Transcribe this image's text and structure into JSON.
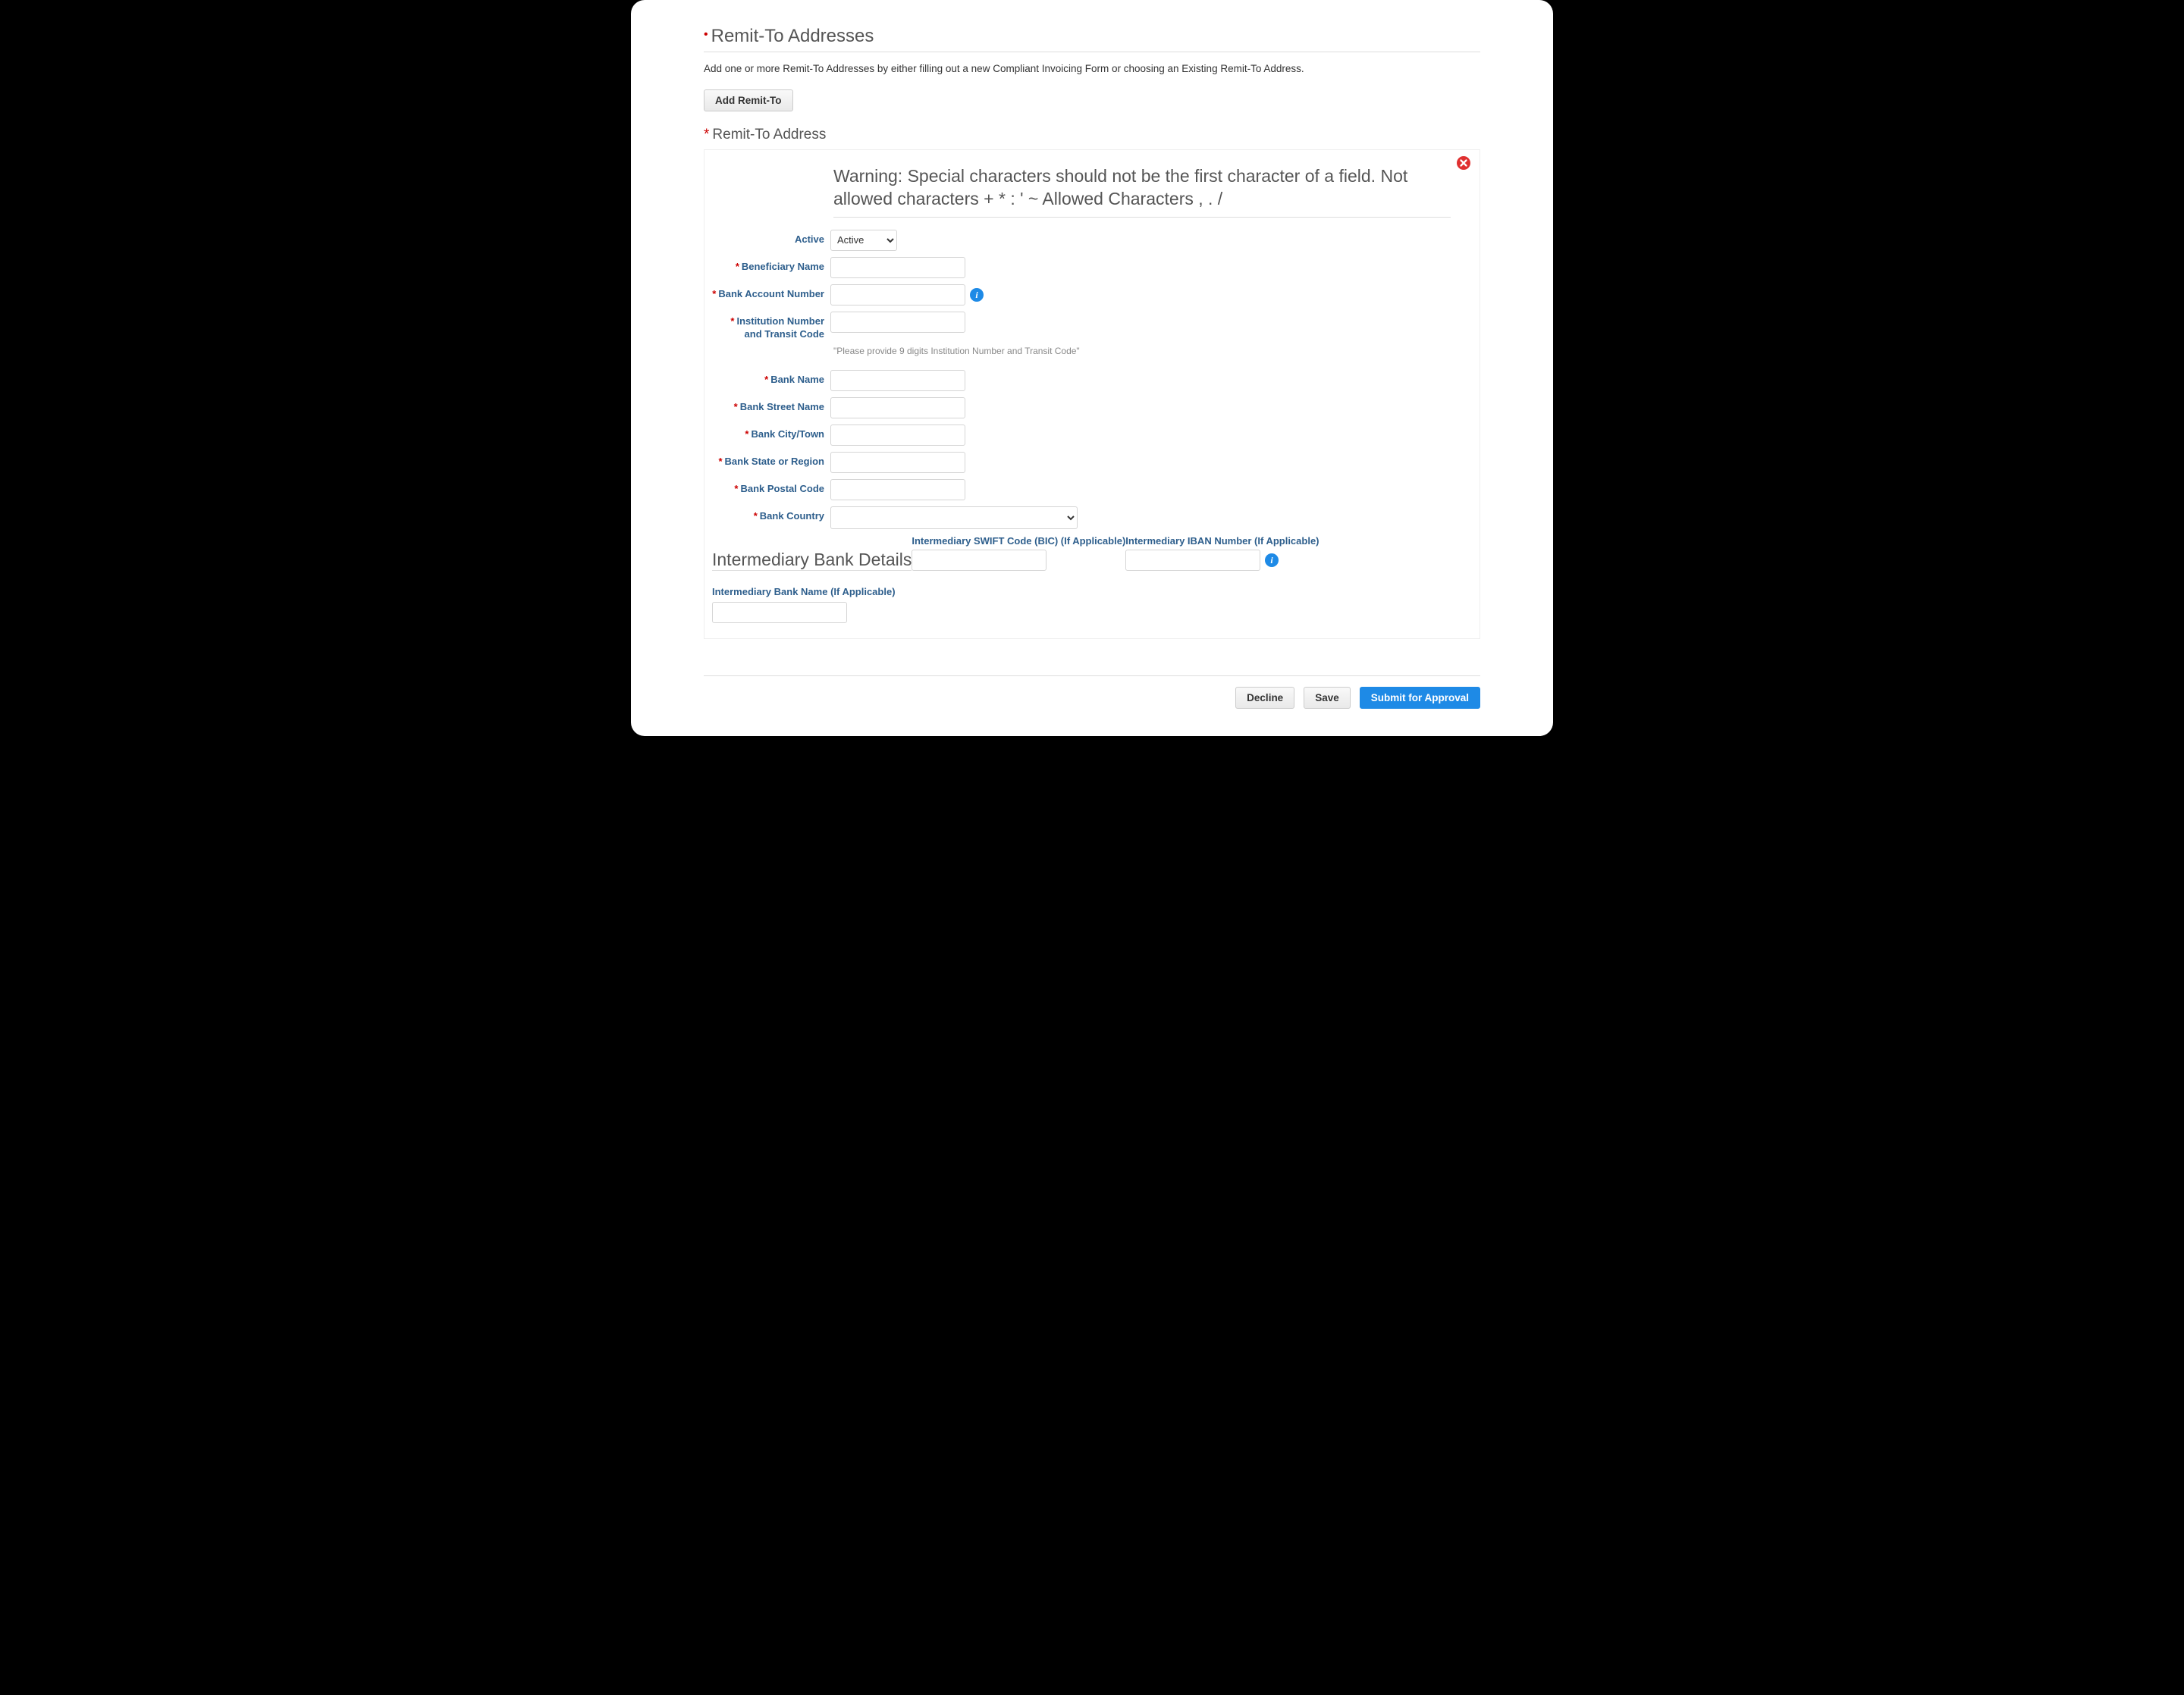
{
  "section": {
    "title": "Remit-To Addresses",
    "intro": "Add one or more Remit-To Addresses by either filling out a new Compliant Invoicing Form or choosing an Existing Remit-To Address.",
    "add_button": "Add Remit-To",
    "sub_title": "Remit-To Address"
  },
  "warning": "Warning: Special characters should not be the first character of a field. Not allowed characters + * : ' ~ Allowed Characters , . /",
  "fields": {
    "active": {
      "label": "Active",
      "value": "Active"
    },
    "beneficiary_name": {
      "label": "Beneficiary Name",
      "value": ""
    },
    "bank_account_number": {
      "label": "Bank Account Number",
      "value": ""
    },
    "institution_transit": {
      "label": "Institution Number and Transit Code",
      "value": "",
      "help": "\"Please provide 9 digits Institution Number and Transit Code\""
    },
    "bank_name": {
      "label": "Bank Name",
      "value": ""
    },
    "bank_street": {
      "label": "Bank Street Name",
      "value": ""
    },
    "bank_city": {
      "label": "Bank City/Town",
      "value": ""
    },
    "bank_state": {
      "label": "Bank State or Region",
      "value": ""
    },
    "bank_postal": {
      "label": "Bank Postal Code",
      "value": ""
    },
    "bank_country": {
      "label": "Bank Country",
      "value": ""
    }
  },
  "intermediary": {
    "heading": "Intermediary Bank Details",
    "swift": {
      "label": "Intermediary SWIFT Code (BIC) (If Applicable)",
      "value": ""
    },
    "iban": {
      "label": "Intermediary IBAN Number (If Applicable)",
      "value": ""
    },
    "bank_name": {
      "label": "Intermediary Bank Name (If Applicable)",
      "value": ""
    }
  },
  "footer": {
    "decline": "Decline",
    "save": "Save",
    "submit": "Submit for Approval"
  }
}
